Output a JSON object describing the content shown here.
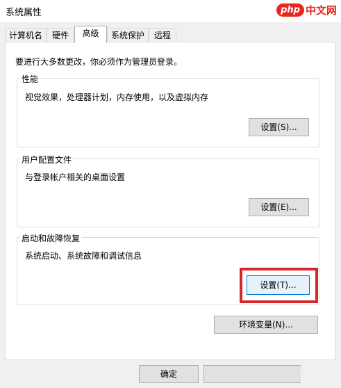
{
  "window": {
    "title": "系统属性"
  },
  "watermark": {
    "logo": "php",
    "text": "中文网"
  },
  "tabs": [
    {
      "label": "计算机名",
      "active": false
    },
    {
      "label": "硬件",
      "active": false
    },
    {
      "label": "高级",
      "active": true
    },
    {
      "label": "系统保护",
      "active": false
    },
    {
      "label": "远程",
      "active": false
    }
  ],
  "notice": "要进行大多数更改，你必须作为管理员登录。",
  "performance": {
    "legend": "性能",
    "description": "视觉效果，处理器计划，内存使用，以及虚拟内存",
    "button": "设置(S)..."
  },
  "user_profiles": {
    "legend": "用户配置文件",
    "description": "与登录帐户相关的桌面设置",
    "button": "设置(E)..."
  },
  "startup_recovery": {
    "legend": "启动和故障恢复",
    "description": "系统启动、系统故障和调试信息",
    "button": "设置(T)..."
  },
  "env_button": "环境变量(N)...",
  "footer": {
    "ok_button": "确定"
  },
  "colors": {
    "highlight": "#d7262b",
    "focus": "#0078d7",
    "brand": "#e8261c"
  }
}
